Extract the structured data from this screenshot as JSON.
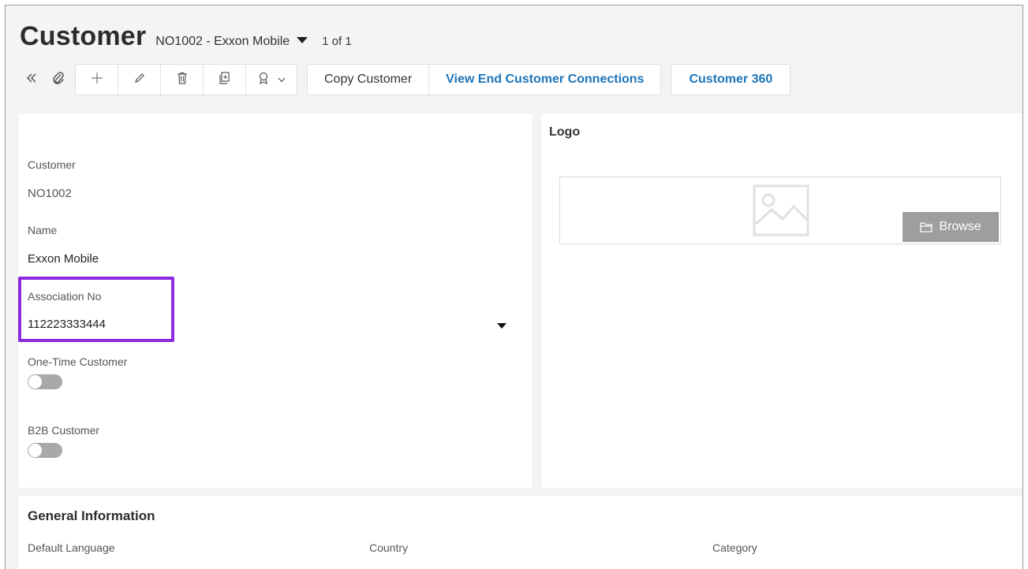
{
  "header": {
    "title": "Customer",
    "record": "NO1002 - Exxon Mobile",
    "count": "1 of 1"
  },
  "toolbar": {
    "icons": [
      "collapse-icon",
      "paperclip-icon",
      "plus-icon",
      "pencil-icon",
      "trash-icon",
      "duplicate-icon",
      "ribbon-icon"
    ],
    "buttons": {
      "copy_customer": "Copy Customer",
      "view_end_customer": "View End Customer Connections",
      "customer_360": "Customer 360"
    }
  },
  "main": {
    "customer": {
      "label": "Customer",
      "value": "NO1002"
    },
    "name": {
      "label": "Name",
      "value": "Exxon Mobile"
    },
    "association_no": {
      "label": "Association No",
      "value": "112223333444"
    },
    "one_time": {
      "label": "One-Time Customer",
      "on": false
    },
    "b2b": {
      "label": "B2B Customer",
      "on": false
    }
  },
  "logo": {
    "title": "Logo",
    "browse_label": "Browse"
  },
  "general": {
    "title": "General Information",
    "default_language": "Default Language",
    "country": "Country",
    "category": "Category"
  },
  "colors": {
    "link": "#1c74b8",
    "highlight": "#8a2be2",
    "toggle_off": "#a9a9a9"
  }
}
